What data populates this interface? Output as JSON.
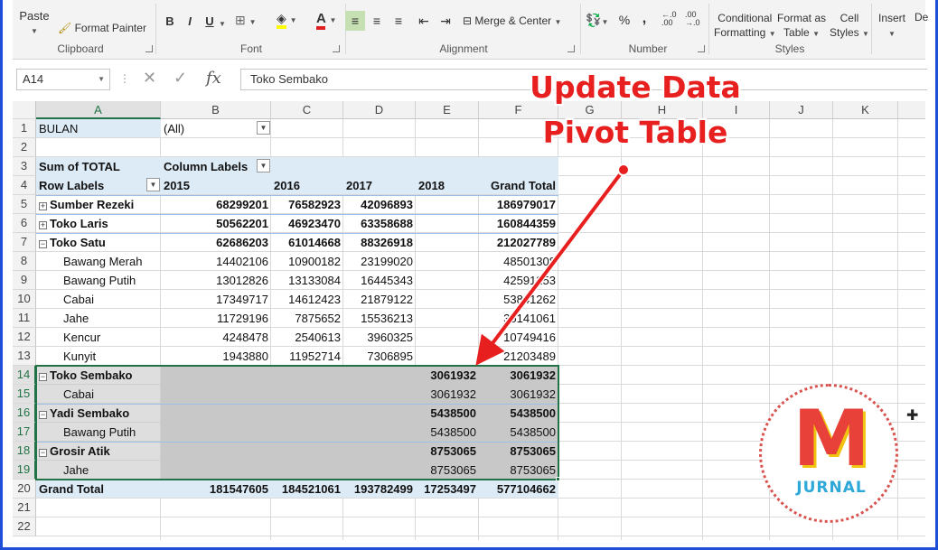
{
  "ribbon": {
    "clipboard": {
      "paste": "Paste",
      "format_painter": "Format Painter",
      "label": "Clipboard"
    },
    "font": {
      "bold": "B",
      "italic": "I",
      "underline": "U",
      "font_color": "A",
      "label": "Font"
    },
    "alignment": {
      "merge_center": "Merge & Center",
      "label": "Alignment"
    },
    "number": {
      "percent": "%",
      "comma": ",",
      "label": "Number"
    },
    "styles": {
      "conditional": "Conditional",
      "formatting": "Formatting",
      "format_as": "Format as",
      "table": "Table",
      "cell": "Cell",
      "cell_styles": "Styles",
      "label": "Styles"
    },
    "cells": {
      "insert": "Insert",
      "delete": "De"
    }
  },
  "formula_bar": {
    "name_box": "A14",
    "fx": "fx",
    "formula": "Toko Sembako"
  },
  "columns": [
    "A",
    "B",
    "C",
    "D",
    "E",
    "F",
    "G",
    "H",
    "I",
    "J",
    "K"
  ],
  "rows": [
    "1",
    "2",
    "3",
    "4",
    "5",
    "6",
    "7",
    "8",
    "9",
    "10",
    "11",
    "12",
    "13",
    "14",
    "15",
    "16",
    "17",
    "18",
    "19",
    "20",
    "21",
    "22"
  ],
  "pivot": {
    "filter_label": "BULAN",
    "filter_value": "(All)",
    "values_label": "Sum of TOTAL",
    "column_labels": "Column Labels",
    "row_labels": "Row Labels",
    "years": [
      "2015",
      "2016",
      "2017",
      "2018"
    ],
    "grand_total_label": "Grand Total",
    "rows": [
      {
        "label": "Sumber Rezeki",
        "level": 0,
        "exp": "+",
        "v": [
          "68299201",
          "76582923",
          "42096893",
          "",
          "186979017"
        ]
      },
      {
        "label": "Toko Laris",
        "level": 0,
        "exp": "+",
        "v": [
          "50562201",
          "46923470",
          "63358688",
          "",
          "160844359"
        ]
      },
      {
        "label": "Toko Satu",
        "level": 0,
        "exp": "−",
        "v": [
          "62686203",
          "61014668",
          "88326918",
          "",
          "212027789"
        ]
      },
      {
        "label": "Bawang Merah",
        "level": 1,
        "exp": "",
        "v": [
          "14402106",
          "10900182",
          "23199020",
          "",
          "48501308"
        ]
      },
      {
        "label": "Bawang Putih",
        "level": 1,
        "exp": "",
        "v": [
          "13012826",
          "13133084",
          "16445343",
          "",
          "42591253"
        ]
      },
      {
        "label": "Cabai",
        "level": 1,
        "exp": "",
        "v": [
          "17349717",
          "14612423",
          "21879122",
          "",
          "53841262"
        ]
      },
      {
        "label": "Jahe",
        "level": 1,
        "exp": "",
        "v": [
          "11729196",
          "7875652",
          "15536213",
          "",
          "35141061"
        ]
      },
      {
        "label": "Kencur",
        "level": 1,
        "exp": "",
        "v": [
          "4248478",
          "2540613",
          "3960325",
          "",
          "10749416"
        ]
      },
      {
        "label": "Kunyit",
        "level": 1,
        "exp": "",
        "v": [
          "1943880",
          "11952714",
          "7306895",
          "",
          "21203489"
        ]
      },
      {
        "label": "Toko Sembako",
        "level": 0,
        "exp": "−",
        "v": [
          "",
          "",
          "",
          "3061932",
          "3061932"
        ]
      },
      {
        "label": "Cabai",
        "level": 1,
        "exp": "",
        "v": [
          "",
          "",
          "",
          "3061932",
          "3061932"
        ]
      },
      {
        "label": "Yadi Sembako",
        "level": 0,
        "exp": "−",
        "v": [
          "",
          "",
          "",
          "5438500",
          "5438500"
        ]
      },
      {
        "label": "Bawang Putih",
        "level": 1,
        "exp": "",
        "v": [
          "",
          "",
          "",
          "5438500",
          "5438500"
        ]
      },
      {
        "label": "Grosir Atik",
        "level": 0,
        "exp": "−",
        "v": [
          "",
          "",
          "",
          "8753065",
          "8753065"
        ]
      },
      {
        "label": "Jahe",
        "level": 1,
        "exp": "",
        "v": [
          "",
          "",
          "",
          "8753065",
          "8753065"
        ]
      }
    ],
    "grand_total": [
      "181547605",
      "184521061",
      "193782499",
      "17253497",
      "577104662"
    ]
  },
  "annotation": {
    "line1": "Update Data",
    "line2": "Pivot Table"
  },
  "logo": {
    "letter": "M",
    "text": "JURNAL"
  },
  "colors": {
    "accent": "#217346",
    "annotation": "#e81f1f",
    "frame": "#1f4fd8",
    "pivot_band": "#ddebf7"
  }
}
